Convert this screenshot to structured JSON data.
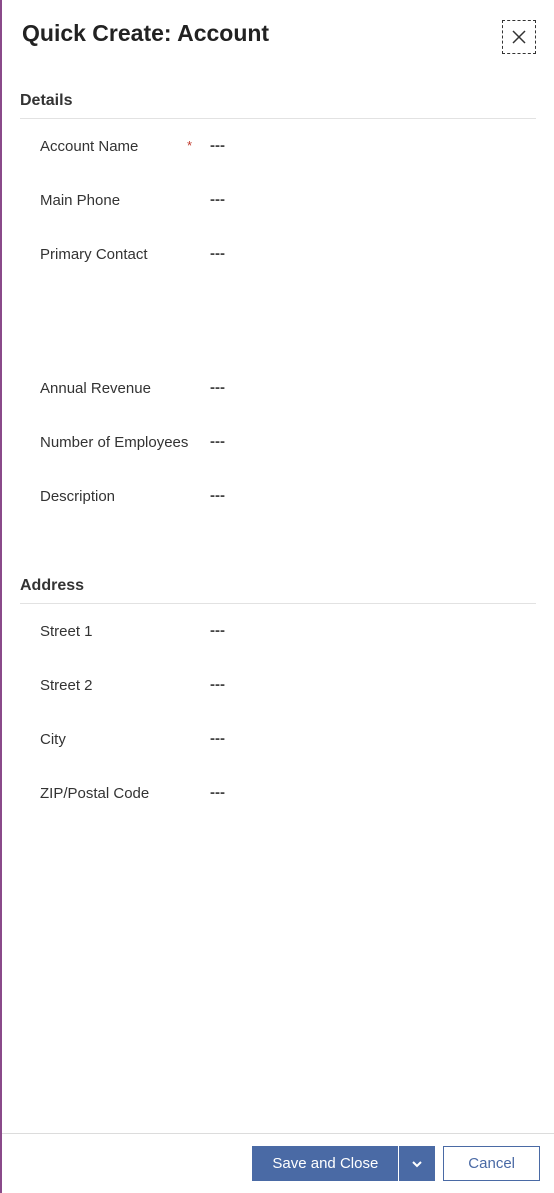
{
  "header": {
    "title": "Quick Create: Account"
  },
  "empty_placeholder": "---",
  "sections": {
    "details": {
      "title": "Details",
      "fields": {
        "account_name": {
          "label": "Account Name",
          "required": true
        },
        "main_phone": {
          "label": "Main Phone",
          "required": false
        },
        "primary_contact": {
          "label": "Primary Contact",
          "required": false
        },
        "annual_revenue": {
          "label": "Annual Revenue",
          "required": false
        },
        "num_employees": {
          "label": "Number of Employees",
          "required": false
        },
        "description": {
          "label": "Description",
          "required": false
        }
      }
    },
    "address": {
      "title": "Address",
      "fields": {
        "street1": {
          "label": "Street 1",
          "required": false
        },
        "street2": {
          "label": "Street 2",
          "required": false
        },
        "city": {
          "label": "City",
          "required": false
        },
        "zip": {
          "label": "ZIP/Postal Code",
          "required": false
        }
      }
    }
  },
  "footer": {
    "save_label": "Save and Close",
    "cancel_label": "Cancel"
  }
}
